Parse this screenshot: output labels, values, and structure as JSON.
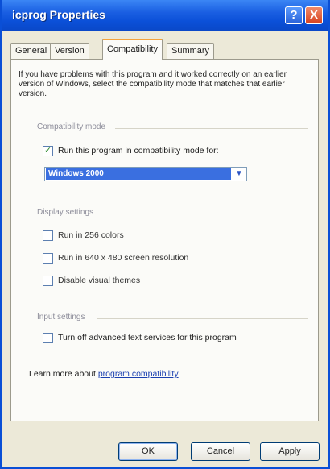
{
  "window": {
    "title": "icprog Properties",
    "help_glyph": "?",
    "close_glyph": "X",
    "accent_color": "#0a4fd6"
  },
  "tabs": [
    {
      "label": "General",
      "active": false
    },
    {
      "label": "Version",
      "active": false
    },
    {
      "label": "Compatibility",
      "active": true
    },
    {
      "label": "Summary",
      "active": false
    }
  ],
  "compat": {
    "intro": "If you have problems with this program and it worked correctly on an earlier version of Windows, select the compatibility mode that matches that earlier version.",
    "mode_group": {
      "label": "Compatibility mode",
      "checkbox_label": "Run this program in compatibility mode for:",
      "checked": true,
      "selected_os": "Windows 2000",
      "dropdown_icon": "chevron-down-icon"
    },
    "display_group": {
      "label": "Display settings",
      "options": [
        {
          "label": "Run in 256 colors",
          "checked": false
        },
        {
          "label": "Run in 640 x 480 screen resolution",
          "checked": false
        },
        {
          "label": "Disable visual themes",
          "checked": false
        }
      ]
    },
    "input_group": {
      "label": "Input settings",
      "options": [
        {
          "label": "Turn off advanced text services for this program",
          "checked": false
        }
      ]
    },
    "learn_more_prefix": "Learn more about",
    "learn_more_link": "program compatibility"
  },
  "buttons": {
    "ok": "OK",
    "cancel": "Cancel",
    "apply": "Apply"
  },
  "check_glyph": "✓"
}
